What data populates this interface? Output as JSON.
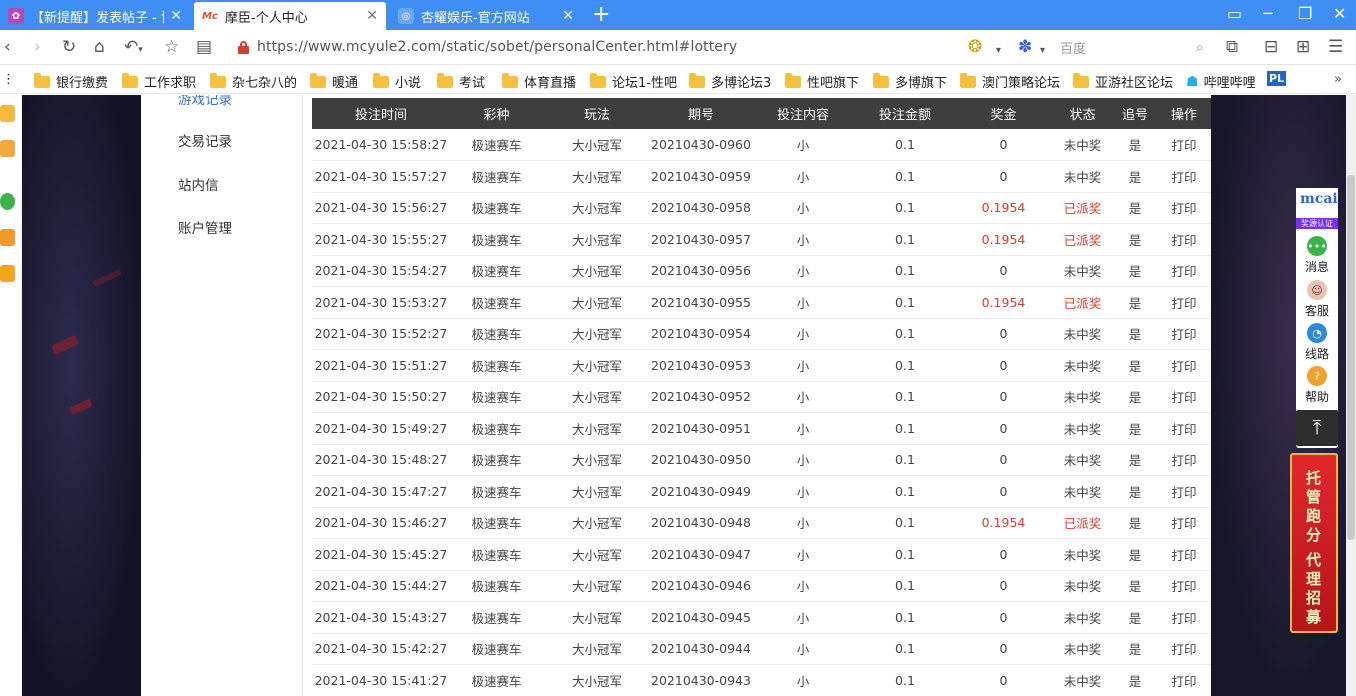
{
  "browser": {
    "tabs": [
      {
        "title": "【新提醒】发表帖子 - 博马",
        "active": false
      },
      {
        "title": "摩臣-个人中心",
        "active": true
      },
      {
        "title": "杏耀娱乐-官方网站",
        "active": false
      }
    ],
    "url": "https://www.mcyule2.com/static/sobet/personalCenter.html#lottery",
    "search_placeholder": "百度",
    "bookmarks": [
      "银行缴费",
      "工作求职",
      "杂七杂八的",
      "暖通",
      "小说",
      "考试",
      "体育直播",
      "论坛1-性吧",
      "多博论坛3",
      "性吧旗下",
      "多博旗下",
      "澳门策略论坛",
      "亚游社区论坛",
      "哔哩哔哩"
    ]
  },
  "sidebar": {
    "cut_item": "游戏记录",
    "items": [
      {
        "label": "交易记录"
      },
      {
        "label": "站内信"
      },
      {
        "label": "账户管理"
      }
    ]
  },
  "table": {
    "headers": [
      "投注时间",
      "彩种",
      "玩法",
      "期号",
      "投注内容",
      "投注金额",
      "奖金",
      "状态",
      "追号",
      "操作"
    ],
    "rows": [
      [
        "2021-04-30 15:58:27",
        "极速赛车",
        "大小冠军",
        "20210430-0960",
        "小",
        "0.1",
        "0",
        "未中奖",
        "是",
        "打印"
      ],
      [
        "2021-04-30 15:57:27",
        "极速赛车",
        "大小冠军",
        "20210430-0959",
        "小",
        "0.1",
        "0",
        "未中奖",
        "是",
        "打印"
      ],
      [
        "2021-04-30 15:56:27",
        "极速赛车",
        "大小冠军",
        "20210430-0958",
        "小",
        "0.1",
        "0.1954",
        "已派奖",
        "是",
        "打印"
      ],
      [
        "2021-04-30 15:55:27",
        "极速赛车",
        "大小冠军",
        "20210430-0957",
        "小",
        "0.1",
        "0.1954",
        "已派奖",
        "是",
        "打印"
      ],
      [
        "2021-04-30 15:54:27",
        "极速赛车",
        "大小冠军",
        "20210430-0956",
        "小",
        "0.1",
        "0",
        "未中奖",
        "是",
        "打印"
      ],
      [
        "2021-04-30 15:53:27",
        "极速赛车",
        "大小冠军",
        "20210430-0955",
        "小",
        "0.1",
        "0.1954",
        "已派奖",
        "是",
        "打印"
      ],
      [
        "2021-04-30 15:52:27",
        "极速赛车",
        "大小冠军",
        "20210430-0954",
        "小",
        "0.1",
        "0",
        "未中奖",
        "是",
        "打印"
      ],
      [
        "2021-04-30 15:51:27",
        "极速赛车",
        "大小冠军",
        "20210430-0953",
        "小",
        "0.1",
        "0",
        "未中奖",
        "是",
        "打印"
      ],
      [
        "2021-04-30 15:50:27",
        "极速赛车",
        "大小冠军",
        "20210430-0952",
        "小",
        "0.1",
        "0",
        "未中奖",
        "是",
        "打印"
      ],
      [
        "2021-04-30 15:49:27",
        "极速赛车",
        "大小冠军",
        "20210430-0951",
        "小",
        "0.1",
        "0",
        "未中奖",
        "是",
        "打印"
      ],
      [
        "2021-04-30 15:48:27",
        "极速赛车",
        "大小冠军",
        "20210430-0950",
        "小",
        "0.1",
        "0",
        "未中奖",
        "是",
        "打印"
      ],
      [
        "2021-04-30 15:47:27",
        "极速赛车",
        "大小冠军",
        "20210430-0949",
        "小",
        "0.1",
        "0",
        "未中奖",
        "是",
        "打印"
      ],
      [
        "2021-04-30 15:46:27",
        "极速赛车",
        "大小冠军",
        "20210430-0948",
        "小",
        "0.1",
        "0.1954",
        "已派奖",
        "是",
        "打印"
      ],
      [
        "2021-04-30 15:45:27",
        "极速赛车",
        "大小冠军",
        "20210430-0947",
        "小",
        "0.1",
        "0",
        "未中奖",
        "是",
        "打印"
      ],
      [
        "2021-04-30 15:44:27",
        "极速赛车",
        "大小冠军",
        "20210430-0946",
        "小",
        "0.1",
        "0",
        "未中奖",
        "是",
        "打印"
      ],
      [
        "2021-04-30 15:43:27",
        "极速赛车",
        "大小冠军",
        "20210430-0945",
        "小",
        "0.1",
        "0",
        "未中奖",
        "是",
        "打印"
      ],
      [
        "2021-04-30 15:42:27",
        "极速赛车",
        "大小冠军",
        "20210430-0944",
        "小",
        "0.1",
        "0",
        "未中奖",
        "是",
        "打印"
      ],
      [
        "2021-04-30 15:41:27",
        "极速赛车",
        "大小冠军",
        "20210430-0943",
        "小",
        "0.1",
        "0",
        "未中奖",
        "是",
        "打印"
      ]
    ],
    "won_status": "已派奖",
    "won_color": "#e23a2b"
  },
  "float_panel": {
    "logo": "mcai",
    "cert": "奖源认证",
    "items": [
      {
        "label": "消息",
        "icon": "chat-icon",
        "color": "#3ab44a"
      },
      {
        "label": "客服",
        "icon": "agent-avatar-icon",
        "color": "#c0392b"
      },
      {
        "label": "线路",
        "icon": "speed-gauge-icon",
        "color": "#2a8ad8"
      },
      {
        "label": "帮助",
        "icon": "question-icon",
        "color": "#f0a22a"
      }
    ],
    "top_icon": "arrow-top-icon"
  },
  "banner": {
    "line1": "托管跑分",
    "line2": "代理招募"
  }
}
